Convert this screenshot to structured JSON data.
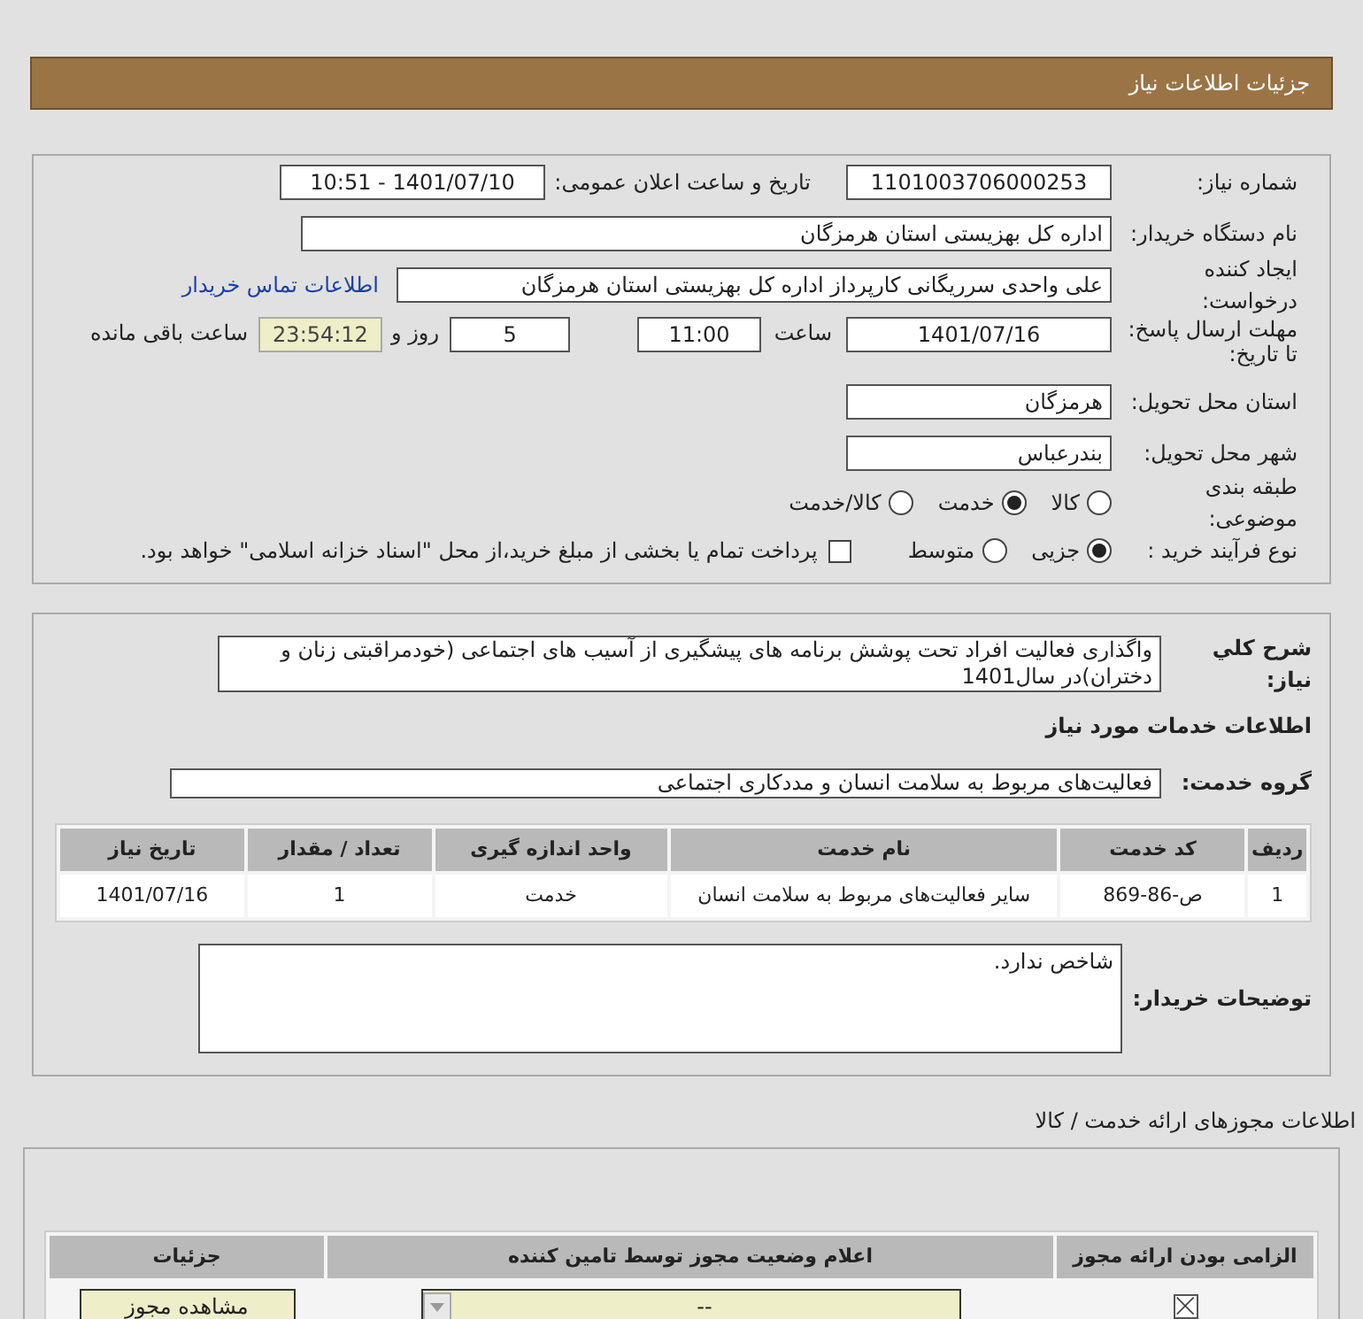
{
  "page_title": "جزئیات اطلاعات نیاز",
  "need_info": {
    "need_number": {
      "label": "شماره نیاز:",
      "value": "1101003706000253"
    },
    "announce_datetime": {
      "label": "تاریخ و ساعت اعلان عمومی:",
      "value": "1401/07/10 - 10:51"
    },
    "buyer_org": {
      "label": "نام دستگاه خریدار:",
      "value": "اداره کل بهزیستی استان هرمزگان"
    },
    "requester": {
      "label": "ایجاد کننده درخواست:",
      "value": "علی  واحدی سرریگانی کارپرداز اداره کل بهزیستی استان هرمزگان",
      "contact_link": "اطلاعات تماس خریدار"
    },
    "deadline": {
      "label": "مهلت ارسال پاسخ: تا تاریخ:",
      "date": "1401/07/16",
      "time_label": "ساعت",
      "time": "11:00",
      "days": "5",
      "days_label": "روز و",
      "remaining": "23:54:12",
      "remaining_label": "ساعت باقی مانده"
    },
    "delivery_province": {
      "label": "استان محل تحویل:",
      "value": "هرمزگان"
    },
    "delivery_city": {
      "label": "شهر محل تحویل:",
      "value": "بندرعباس"
    },
    "category": {
      "label": "طبقه بندی موضوعی:",
      "options": [
        {
          "label": "کالا",
          "selected": false
        },
        {
          "label": "خدمت",
          "selected": true
        },
        {
          "label": "کالا/خدمت",
          "selected": false
        }
      ]
    },
    "purchase_process": {
      "label": "نوع فرآیند خرید :",
      "options": [
        {
          "label": "جزیی",
          "selected": true
        },
        {
          "label": "متوسط",
          "selected": false
        }
      ],
      "payment_checkbox": {
        "label": "پرداخت تمام یا بخشی از مبلغ خرید،از محل \"اسناد خزانه اسلامی\" خواهد بود.",
        "checked": false
      }
    }
  },
  "services": {
    "description": {
      "label": "شرح کلي نياز:",
      "value": "واگذاری فعالیت افراد تحت پوشش برنامه های پیشگیری از آسیب های اجتماعی (خودمراقبتی زنان و دختران)در سال1401"
    },
    "section_title": "اطلاعات خدمات مورد نیاز",
    "service_group": {
      "label": "گروه خدمت:",
      "value": "فعالیت‌های مربوط به سلامت انسان و مددکاری اجتماعی"
    },
    "table": {
      "columns": [
        "ردیف",
        "کد خدمت",
        "نام خدمت",
        "واحد اندازه گیری",
        "تعداد / مقدار",
        "تاریخ نیاز"
      ],
      "rows": [
        [
          "1",
          "ص-86-869",
          "سایر فعالیت‌های مربوط به سلامت انسان",
          "خدمت",
          "1",
          "1401/07/16"
        ]
      ]
    },
    "buyer_notes": {
      "label": "توضیحات خریدار:",
      "value": "شاخص ندارد."
    }
  },
  "permits": {
    "title": "اطلاعات مجوزهای ارائه خدمت / کالا",
    "table": {
      "columns": [
        "الزامی بودن ارائه مجوز",
        "اعلام وضعیت مجوز توسط تامین کننده",
        "جزئیات"
      ],
      "rows": [
        {
          "required": true,
          "status": "--",
          "action": "مشاهده مجوز"
        }
      ]
    }
  }
}
